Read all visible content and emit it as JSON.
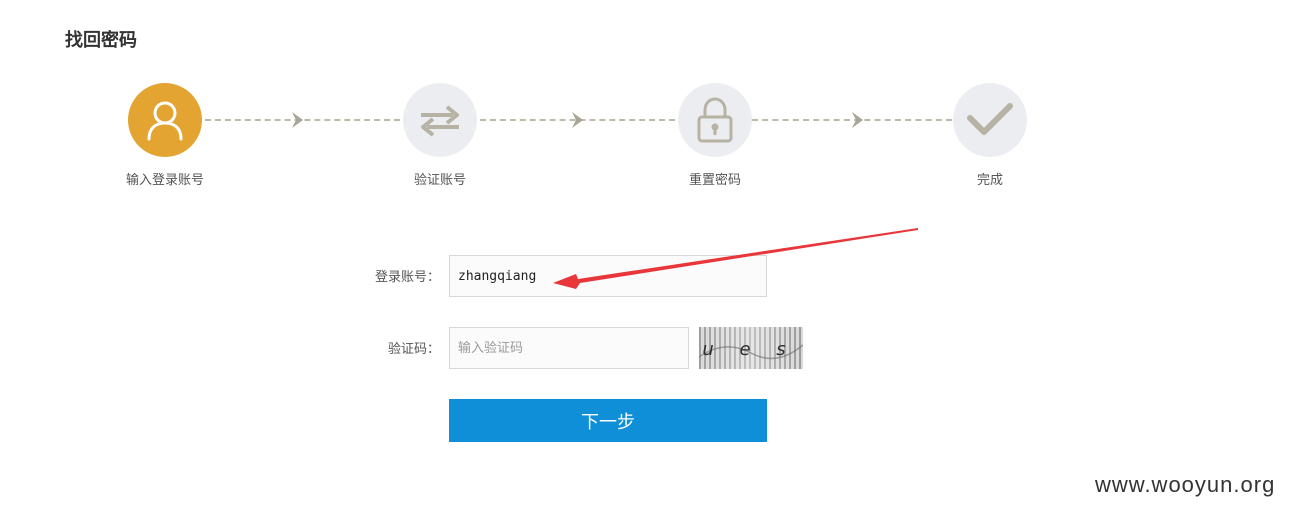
{
  "page": {
    "title": "找回密码"
  },
  "steps": [
    {
      "label": "输入登录账号",
      "icon": "user-icon",
      "state": "active"
    },
    {
      "label": "验证账号",
      "icon": "swap-arrows-icon",
      "state": "pending"
    },
    {
      "label": "重置密码",
      "icon": "lock-icon",
      "state": "pending"
    },
    {
      "label": "完成",
      "icon": "checkmark-icon",
      "state": "pending"
    }
  ],
  "form": {
    "account_label": "登录账号：",
    "account_value": "zhangqiang",
    "captcha_label": "验证码：",
    "captcha_placeholder": "输入验证码",
    "captcha_text": "u e s",
    "next_button": "下一步"
  },
  "watermark": "www.wooyun.org",
  "colors": {
    "active_step": "#e3a432",
    "pending_step": "#ecedf1",
    "primary_button": "#0f8fd8",
    "annotation_arrow": "#e8363a"
  }
}
